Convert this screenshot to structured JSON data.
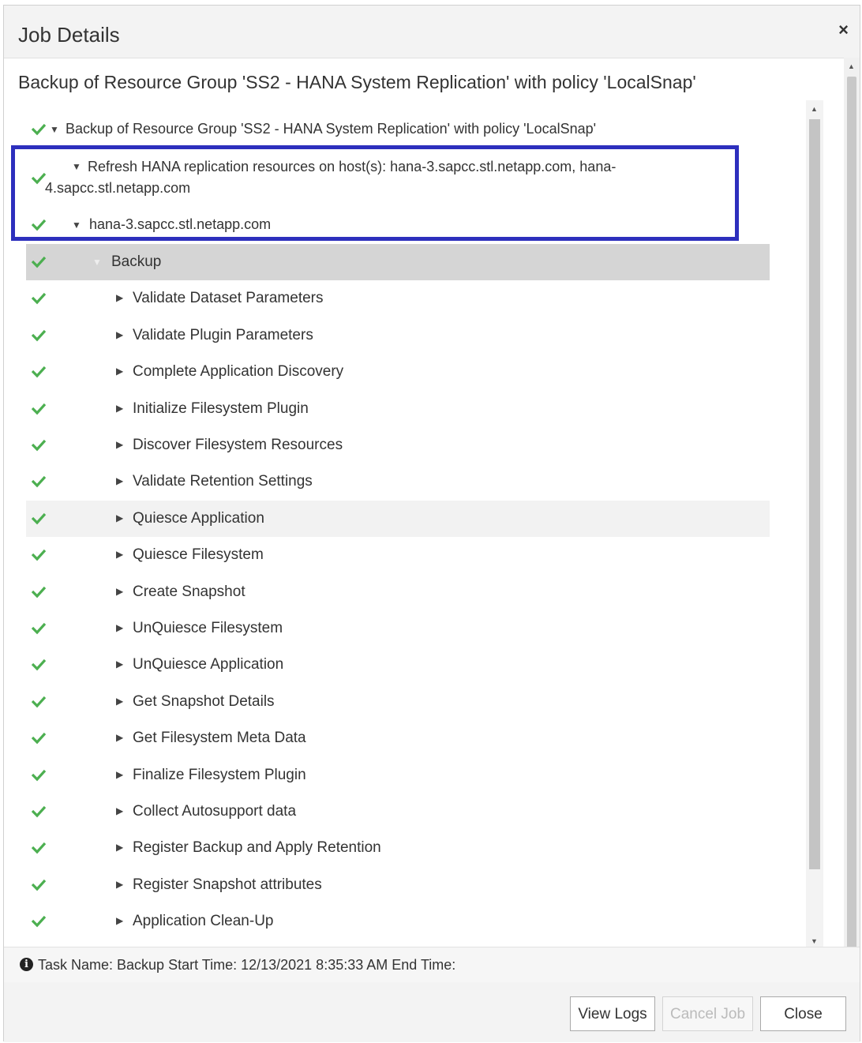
{
  "dialog": {
    "title": "Job Details",
    "close_glyph": "×",
    "subheading": "Backup of Resource Group 'SS2 - HANA System Replication' with policy 'LocalSnap'"
  },
  "tree": {
    "check_color": "#4caf50",
    "highlight_color": "#2d2fbd",
    "nodes": [
      {
        "label": "Backup of Resource Group 'SS2 - HANA System Replication' with policy 'LocalSnap'",
        "state": "expanded",
        "status": "success"
      },
      {
        "label_line1": "Refresh HANA replication resources on host(s): hana-3.sapcc.stl.netapp.com, hana-",
        "label_line2": "4.sapcc.stl.netapp.com",
        "state": "expanded",
        "status": "success"
      },
      {
        "label": "hana-3.sapcc.stl.netapp.com",
        "state": "expanded",
        "status": "success"
      },
      {
        "label": "Backup",
        "state": "expanded",
        "status": "success",
        "selected": true
      },
      {
        "label": "Validate Dataset Parameters",
        "state": "collapsed",
        "status": "success"
      },
      {
        "label": "Validate Plugin Parameters",
        "state": "collapsed",
        "status": "success"
      },
      {
        "label": "Complete Application Discovery",
        "state": "collapsed",
        "status": "success"
      },
      {
        "label": "Initialize Filesystem Plugin",
        "state": "collapsed",
        "status": "success"
      },
      {
        "label": "Discover Filesystem Resources",
        "state": "collapsed",
        "status": "success"
      },
      {
        "label": "Validate Retention Settings",
        "state": "collapsed",
        "status": "success"
      },
      {
        "label": "Quiesce Application",
        "state": "collapsed",
        "status": "success"
      },
      {
        "label": "Quiesce Filesystem",
        "state": "collapsed",
        "status": "success"
      },
      {
        "label": "Create Snapshot",
        "state": "collapsed",
        "status": "success"
      },
      {
        "label": "UnQuiesce Filesystem",
        "state": "collapsed",
        "status": "success"
      },
      {
        "label": "UnQuiesce Application",
        "state": "collapsed",
        "status": "success"
      },
      {
        "label": "Get Snapshot Details",
        "state": "collapsed",
        "status": "success"
      },
      {
        "label": "Get Filesystem Meta Data",
        "state": "collapsed",
        "status": "success"
      },
      {
        "label": "Finalize Filesystem Plugin",
        "state": "collapsed",
        "status": "success"
      },
      {
        "label": "Collect Autosupport data",
        "state": "collapsed",
        "status": "success"
      },
      {
        "label": "Register Backup and Apply Retention",
        "state": "collapsed",
        "status": "success"
      },
      {
        "label": "Register Snapshot attributes",
        "state": "collapsed",
        "status": "success"
      },
      {
        "label": "Application Clean-Up",
        "state": "collapsed",
        "status": "success"
      }
    ]
  },
  "status": {
    "icon": "info-icon",
    "icon_glyph": "i",
    "text": "Task Name: Backup Start Time: 12/13/2021 8:35:33 AM End Time:"
  },
  "footer": {
    "view_logs_label": "View Logs",
    "cancel_job_label": "Cancel Job",
    "close_label": "Close"
  }
}
